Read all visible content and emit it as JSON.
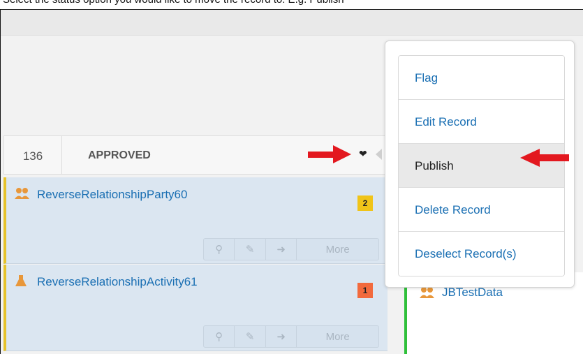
{
  "caption": "Select the status option you would like to move the record to: E.g. Publish",
  "column": {
    "count": "136",
    "title": "APPROVED"
  },
  "records": [
    {
      "name": "ReverseRelationshipParty60",
      "badge": "2",
      "badge_color": "#f0c419",
      "icon": "people-icon"
    },
    {
      "name": "ReverseRelationshipActivity61",
      "badge": "1",
      "badge_color": "#f26a3d",
      "icon": "flask-icon"
    }
  ],
  "actions": {
    "view": "search-icon",
    "edit": "edit-icon",
    "share": "share-arrow-icon",
    "more": "More"
  },
  "menu": {
    "items": [
      {
        "label": "Flag"
      },
      {
        "label": "Edit Record"
      },
      {
        "label": "Publish",
        "active": true
      },
      {
        "label": "Delete Record"
      },
      {
        "label": "Deselect Record(s)"
      }
    ]
  },
  "other_record": {
    "name": "JBTestData",
    "icon": "people-icon",
    "border_color": "#2fc03a"
  },
  "annotation_arrow_color": "#e3181f"
}
